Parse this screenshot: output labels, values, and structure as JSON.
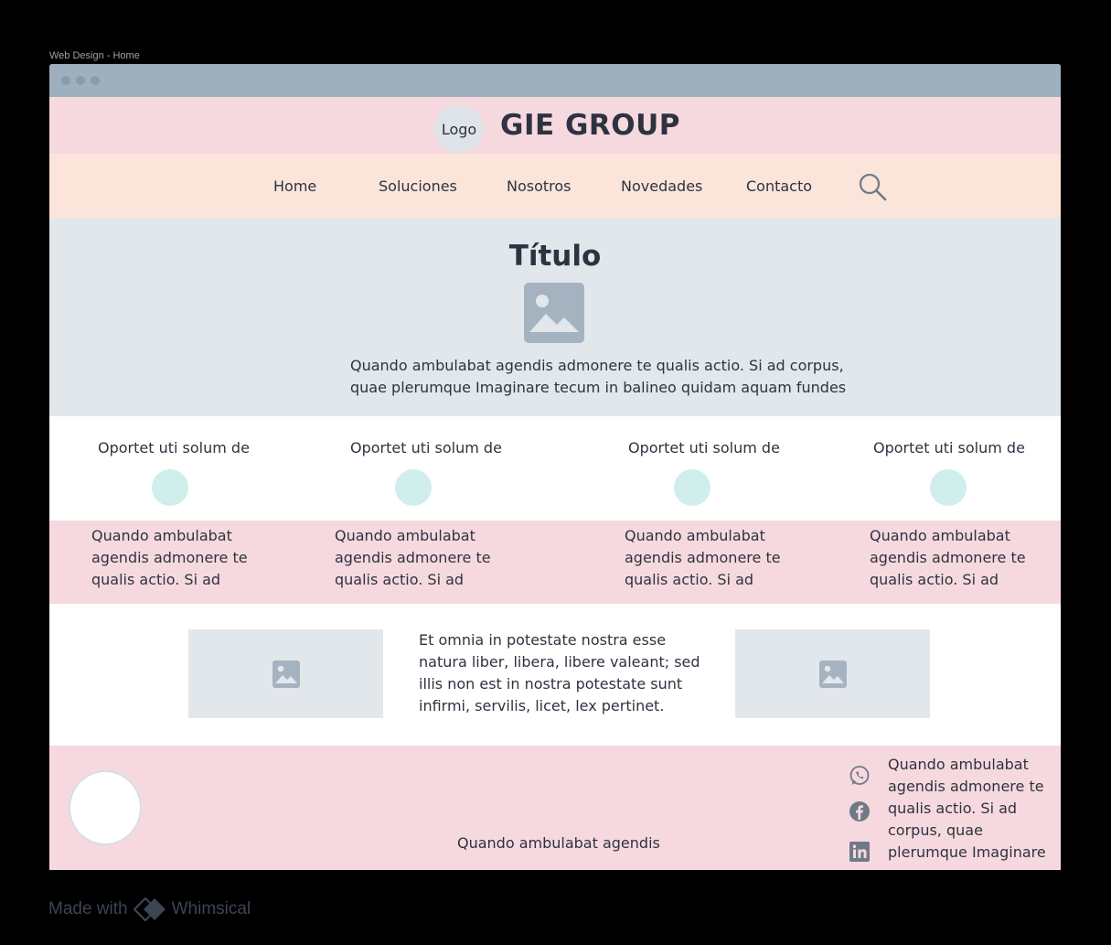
{
  "frame_label": "Web Design - Home",
  "header": {
    "logo_text": "Logo",
    "brand": "GIE GROUP"
  },
  "nav": {
    "items": [
      {
        "label": "Home"
      },
      {
        "label": "Soluciones"
      },
      {
        "label": "Nosotros"
      },
      {
        "label": "Novedades"
      },
      {
        "label": "Contacto"
      }
    ]
  },
  "hero": {
    "title": "Título",
    "text_line1": "Quando ambulabat agendis admonere te qualis actio. Si ad corpus,",
    "text_line2": "quae plerumque Imaginare tecum in balineo quidam aquam fundes"
  },
  "features": [
    {
      "label": "Oportet uti solum de",
      "text": "Quando ambulabat agendis admonere te qualis actio. Si ad"
    },
    {
      "label": "Oportet uti solum de",
      "text": "Quando ambulabat agendis admonere te qualis actio. Si ad"
    },
    {
      "label": "Oportet uti solum de",
      "text": "Quando ambulabat agendis admonere te qualis actio. Si ad"
    },
    {
      "label": "Oportet uti solum de",
      "text": "Quando ambulabat agendis admonere te qualis actio. Si ad"
    }
  ],
  "middle": {
    "text": "Et omnia in potestate nostra esse natura liber, libera, libere valeant; sed illis non est in nostra potestate sunt infirmi, servilis, licet, lex pertinet."
  },
  "footer": {
    "center_text": "Quando ambulabat agendis",
    "side_text": "Quando ambulabat agendis admonere te qualis actio. Si ad corpus, quae plerumque Imaginare",
    "social_icons": [
      "whatsapp-icon",
      "facebook-icon",
      "linkedin-icon"
    ]
  },
  "watermark": {
    "prefix": "Made with",
    "brand": "Whimsical"
  },
  "colors": {
    "header_bg": "#f6d9de",
    "nav_bg": "#fbe4da",
    "hero_bg": "#e2e7ec",
    "accent_circle": "#cfeeec",
    "titlebar": "#9eafbd"
  }
}
